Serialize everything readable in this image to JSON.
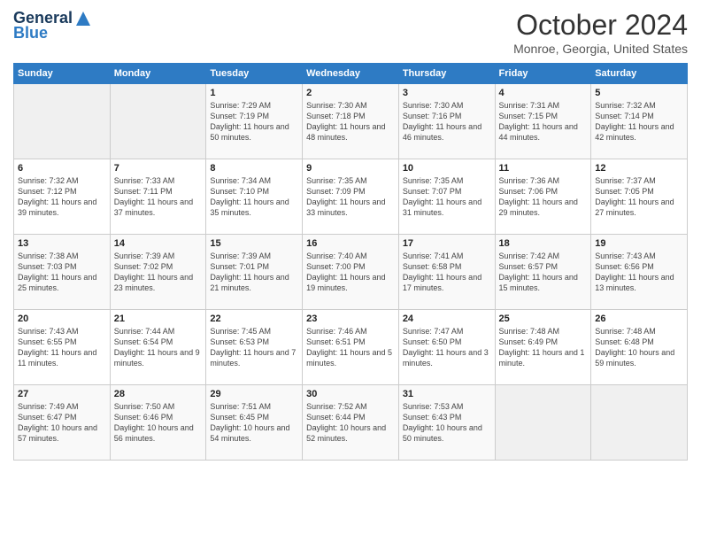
{
  "logo": {
    "general": "General",
    "blue": "Blue"
  },
  "header": {
    "title": "October 2024",
    "location": "Monroe, Georgia, United States"
  },
  "days_of_week": [
    "Sunday",
    "Monday",
    "Tuesday",
    "Wednesday",
    "Thursday",
    "Friday",
    "Saturday"
  ],
  "weeks": [
    [
      {
        "day": "",
        "sunrise": "",
        "sunset": "",
        "daylight": "",
        "empty": true
      },
      {
        "day": "",
        "sunrise": "",
        "sunset": "",
        "daylight": "",
        "empty": true
      },
      {
        "day": "1",
        "sunrise": "Sunrise: 7:29 AM",
        "sunset": "Sunset: 7:19 PM",
        "daylight": "Daylight: 11 hours and 50 minutes."
      },
      {
        "day": "2",
        "sunrise": "Sunrise: 7:30 AM",
        "sunset": "Sunset: 7:18 PM",
        "daylight": "Daylight: 11 hours and 48 minutes."
      },
      {
        "day": "3",
        "sunrise": "Sunrise: 7:30 AM",
        "sunset": "Sunset: 7:16 PM",
        "daylight": "Daylight: 11 hours and 46 minutes."
      },
      {
        "day": "4",
        "sunrise": "Sunrise: 7:31 AM",
        "sunset": "Sunset: 7:15 PM",
        "daylight": "Daylight: 11 hours and 44 minutes."
      },
      {
        "day": "5",
        "sunrise": "Sunrise: 7:32 AM",
        "sunset": "Sunset: 7:14 PM",
        "daylight": "Daylight: 11 hours and 42 minutes."
      }
    ],
    [
      {
        "day": "6",
        "sunrise": "Sunrise: 7:32 AM",
        "sunset": "Sunset: 7:12 PM",
        "daylight": "Daylight: 11 hours and 39 minutes."
      },
      {
        "day": "7",
        "sunrise": "Sunrise: 7:33 AM",
        "sunset": "Sunset: 7:11 PM",
        "daylight": "Daylight: 11 hours and 37 minutes."
      },
      {
        "day": "8",
        "sunrise": "Sunrise: 7:34 AM",
        "sunset": "Sunset: 7:10 PM",
        "daylight": "Daylight: 11 hours and 35 minutes."
      },
      {
        "day": "9",
        "sunrise": "Sunrise: 7:35 AM",
        "sunset": "Sunset: 7:09 PM",
        "daylight": "Daylight: 11 hours and 33 minutes."
      },
      {
        "day": "10",
        "sunrise": "Sunrise: 7:35 AM",
        "sunset": "Sunset: 7:07 PM",
        "daylight": "Daylight: 11 hours and 31 minutes."
      },
      {
        "day": "11",
        "sunrise": "Sunrise: 7:36 AM",
        "sunset": "Sunset: 7:06 PM",
        "daylight": "Daylight: 11 hours and 29 minutes."
      },
      {
        "day": "12",
        "sunrise": "Sunrise: 7:37 AM",
        "sunset": "Sunset: 7:05 PM",
        "daylight": "Daylight: 11 hours and 27 minutes."
      }
    ],
    [
      {
        "day": "13",
        "sunrise": "Sunrise: 7:38 AM",
        "sunset": "Sunset: 7:03 PM",
        "daylight": "Daylight: 11 hours and 25 minutes."
      },
      {
        "day": "14",
        "sunrise": "Sunrise: 7:39 AM",
        "sunset": "Sunset: 7:02 PM",
        "daylight": "Daylight: 11 hours and 23 minutes."
      },
      {
        "day": "15",
        "sunrise": "Sunrise: 7:39 AM",
        "sunset": "Sunset: 7:01 PM",
        "daylight": "Daylight: 11 hours and 21 minutes."
      },
      {
        "day": "16",
        "sunrise": "Sunrise: 7:40 AM",
        "sunset": "Sunset: 7:00 PM",
        "daylight": "Daylight: 11 hours and 19 minutes."
      },
      {
        "day": "17",
        "sunrise": "Sunrise: 7:41 AM",
        "sunset": "Sunset: 6:58 PM",
        "daylight": "Daylight: 11 hours and 17 minutes."
      },
      {
        "day": "18",
        "sunrise": "Sunrise: 7:42 AM",
        "sunset": "Sunset: 6:57 PM",
        "daylight": "Daylight: 11 hours and 15 minutes."
      },
      {
        "day": "19",
        "sunrise": "Sunrise: 7:43 AM",
        "sunset": "Sunset: 6:56 PM",
        "daylight": "Daylight: 11 hours and 13 minutes."
      }
    ],
    [
      {
        "day": "20",
        "sunrise": "Sunrise: 7:43 AM",
        "sunset": "Sunset: 6:55 PM",
        "daylight": "Daylight: 11 hours and 11 minutes."
      },
      {
        "day": "21",
        "sunrise": "Sunrise: 7:44 AM",
        "sunset": "Sunset: 6:54 PM",
        "daylight": "Daylight: 11 hours and 9 minutes."
      },
      {
        "day": "22",
        "sunrise": "Sunrise: 7:45 AM",
        "sunset": "Sunset: 6:53 PM",
        "daylight": "Daylight: 11 hours and 7 minutes."
      },
      {
        "day": "23",
        "sunrise": "Sunrise: 7:46 AM",
        "sunset": "Sunset: 6:51 PM",
        "daylight": "Daylight: 11 hours and 5 minutes."
      },
      {
        "day": "24",
        "sunrise": "Sunrise: 7:47 AM",
        "sunset": "Sunset: 6:50 PM",
        "daylight": "Daylight: 11 hours and 3 minutes."
      },
      {
        "day": "25",
        "sunrise": "Sunrise: 7:48 AM",
        "sunset": "Sunset: 6:49 PM",
        "daylight": "Daylight: 11 hours and 1 minute."
      },
      {
        "day": "26",
        "sunrise": "Sunrise: 7:48 AM",
        "sunset": "Sunset: 6:48 PM",
        "daylight": "Daylight: 10 hours and 59 minutes."
      }
    ],
    [
      {
        "day": "27",
        "sunrise": "Sunrise: 7:49 AM",
        "sunset": "Sunset: 6:47 PM",
        "daylight": "Daylight: 10 hours and 57 minutes."
      },
      {
        "day": "28",
        "sunrise": "Sunrise: 7:50 AM",
        "sunset": "Sunset: 6:46 PM",
        "daylight": "Daylight: 10 hours and 56 minutes."
      },
      {
        "day": "29",
        "sunrise": "Sunrise: 7:51 AM",
        "sunset": "Sunset: 6:45 PM",
        "daylight": "Daylight: 10 hours and 54 minutes."
      },
      {
        "day": "30",
        "sunrise": "Sunrise: 7:52 AM",
        "sunset": "Sunset: 6:44 PM",
        "daylight": "Daylight: 10 hours and 52 minutes."
      },
      {
        "day": "31",
        "sunrise": "Sunrise: 7:53 AM",
        "sunset": "Sunset: 6:43 PM",
        "daylight": "Daylight: 10 hours and 50 minutes."
      },
      {
        "day": "",
        "sunrise": "",
        "sunset": "",
        "daylight": "",
        "empty": true
      },
      {
        "day": "",
        "sunrise": "",
        "sunset": "",
        "daylight": "",
        "empty": true
      }
    ]
  ]
}
